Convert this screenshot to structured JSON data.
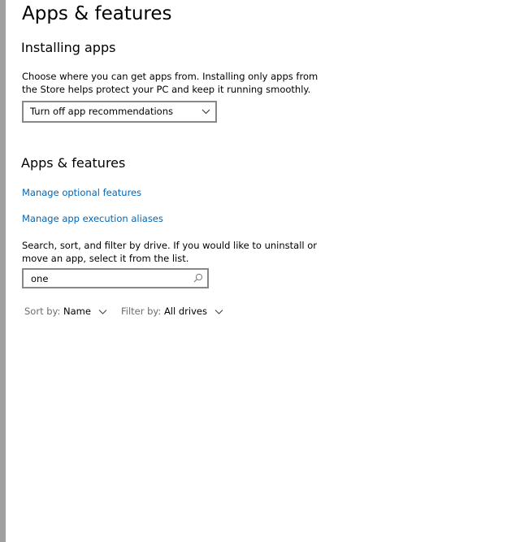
{
  "page": {
    "title": "Apps & features"
  },
  "installing": {
    "heading": "Installing apps",
    "description": "Choose where you can get apps from. Installing only apps from the Store helps protect your PC and keep it running smoothly.",
    "dropdown_value": "Turn off app recommendations"
  },
  "apps_features": {
    "heading": "Apps & features",
    "link_optional": "Manage optional features",
    "link_aliases": "Manage app execution aliases",
    "description": "Search, sort, and filter by drive. If you would like to uninstall or move an app, select it from the list.",
    "search_value": "one"
  },
  "sort": {
    "label": "Sort by:",
    "value": "Name"
  },
  "filter": {
    "label": "Filter by:",
    "value": "All drives"
  },
  "colors": {
    "link": "#0067b8",
    "border": "#888888",
    "muted_text": "#6d6d6d"
  },
  "icons": {
    "dropdown": "chevron-down-icon",
    "search": "search-icon"
  }
}
